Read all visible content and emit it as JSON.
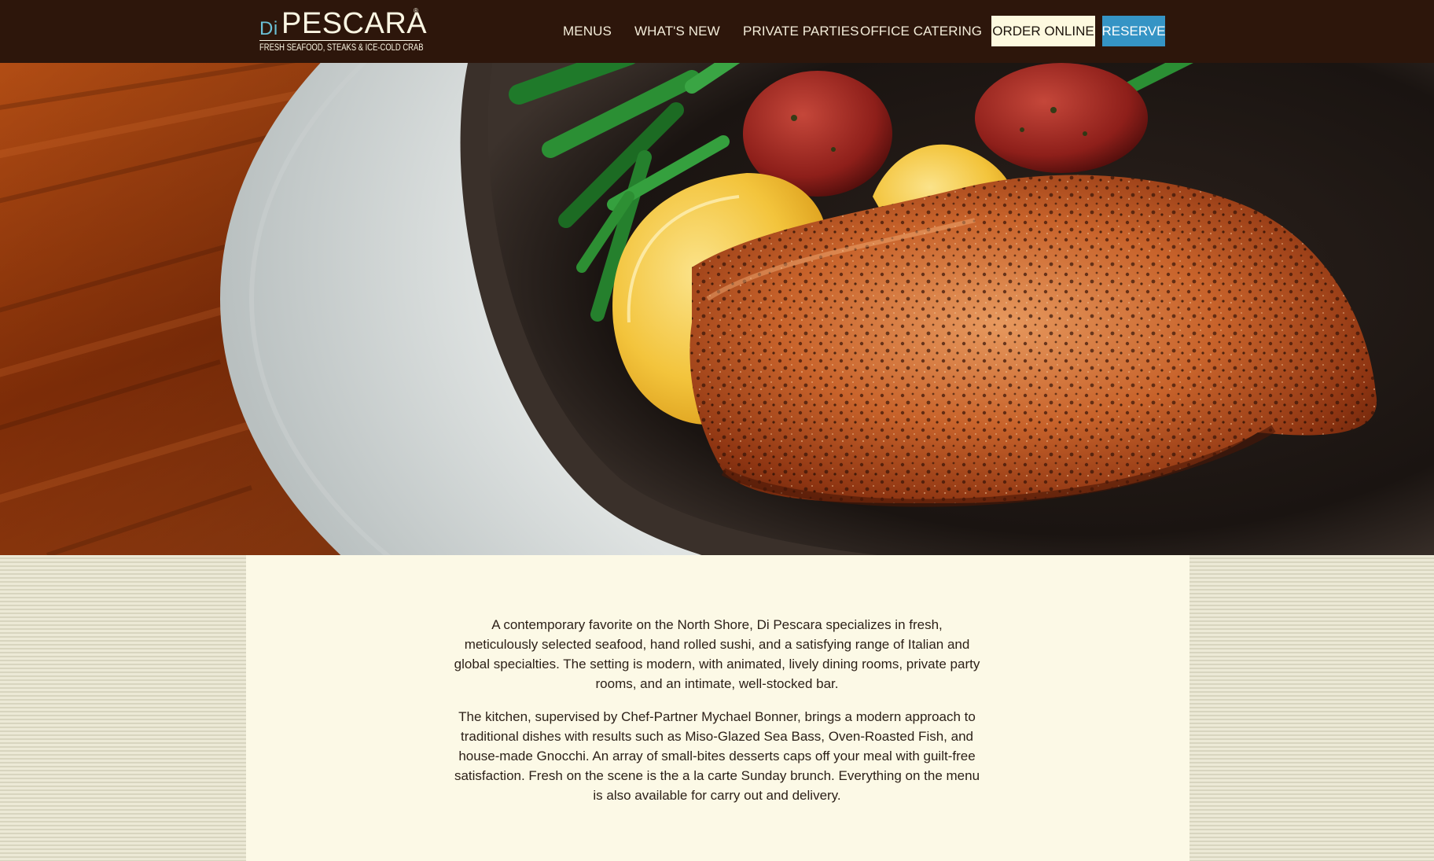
{
  "brand": {
    "prefix": "Di",
    "name": "PESCARA",
    "registered_mark": "®",
    "tagline": "FRESH SEAFOOD, STEAKS & ICE-COLD CRAB"
  },
  "nav": {
    "items": [
      {
        "label": "MENUS"
      },
      {
        "label": "WHAT'S NEW"
      },
      {
        "label": "PRIVATE PARTIES"
      },
      {
        "label": "OFFICE CATERING"
      }
    ],
    "order_button": "ORDER ONLINE",
    "reserve_button": "RESERVE"
  },
  "colors": {
    "header_bg": "#2d160b",
    "content_bg": "#fcf9e6",
    "reserve_accent": "#3594c5",
    "logo_accent": "#6bc0d6"
  },
  "hero": {
    "image_subject": "blackened salmon fillet with lemon wedges, green beans and roasted potatoes in a cast-iron dish"
  },
  "content": {
    "paragraphs": [
      "A contemporary favorite on the North Shore, Di Pescara specializes in fresh, meticulously selected seafood, hand rolled sushi, and a satisfying range of Italian and global specialties. The setting is modern, with animated, lively dining rooms, private party rooms, and an intimate, well-stocked bar.",
      "The kitchen, supervised by Chef-Partner Mychael Bonner, brings a modern approach to traditional dishes with results such as Miso-Glazed Sea Bass, Oven-Roasted Fish, and house-made Gnocchi. An array of small-bites desserts caps off your meal with guilt-free satisfaction. Fresh on the scene is the a la carte Sunday brunch. Everything on the menu is also available for carry out and delivery."
    ]
  }
}
